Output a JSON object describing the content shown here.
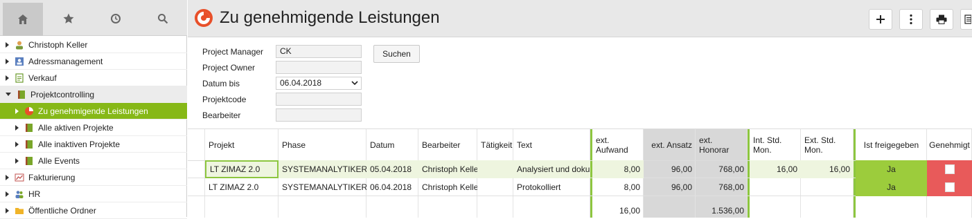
{
  "sidebar": {
    "items": [
      {
        "label": "Christoph Keller"
      },
      {
        "label": "Adressmanagement"
      },
      {
        "label": "Verkauf"
      },
      {
        "label": "Projektcontrolling"
      },
      {
        "label": "Zu genehmigende Leistungen"
      },
      {
        "label": "Alle aktiven Projekte"
      },
      {
        "label": "Alle inaktiven Projekte"
      },
      {
        "label": "Alle Events"
      },
      {
        "label": "Fakturierung"
      },
      {
        "label": "HR"
      },
      {
        "label": "Öffentliche Ordner"
      }
    ]
  },
  "header": {
    "title": "Zu genehmigende Leistungen"
  },
  "filters": {
    "project_manager": {
      "label": "Project Manager",
      "value": "CK"
    },
    "project_owner": {
      "label": "Project Owner",
      "value": ""
    },
    "date_until": {
      "label": "Datum bis",
      "value": "06.04.2018"
    },
    "project_code": {
      "label": "Projektcode",
      "value": ""
    },
    "editor": {
      "label": "Bearbeiter",
      "value": ""
    },
    "search_label": "Suchen"
  },
  "table": {
    "columns": [
      "Projekt",
      "Phase",
      "Datum",
      "Bearbeiter",
      "Tätigkeit",
      "Text",
      "ext. Aufwand",
      "ext. Ansatz",
      "ext. Honorar",
      "Int. Std. Mon.",
      "Ext. Std. Mon.",
      "Ist freigegeben",
      "Genehmigt"
    ],
    "rows": [
      {
        "projekt": "LT ZIMAZ 2.0",
        "phase": "SYSTEMANALYTIKER",
        "datum": "05.04.2018",
        "bearbeiter": "Christoph Keller",
        "taetigkeit": "",
        "text": "Analysiert und doku...",
        "ext_aufwand": "8,00",
        "ext_ansatz": "96,00",
        "ext_honorar": "768,00",
        "int_std": "16,00",
        "ext_std": "16,00",
        "freigegeben": "Ja"
      },
      {
        "projekt": "LT ZIMAZ 2.0",
        "phase": "SYSTEMANALYTIKER",
        "datum": "06.04.2018",
        "bearbeiter": "Christoph Keller",
        "taetigkeit": "",
        "text": "Protokolliert",
        "ext_aufwand": "8,00",
        "ext_ansatz": "96,00",
        "ext_honorar": "768,00",
        "int_std": "",
        "ext_std": "",
        "freigegeben": "Ja"
      }
    ],
    "totals": {
      "ext_aufwand": "16,00",
      "ext_honorar": "1.536,00"
    }
  },
  "colors": {
    "accent": "#86b817",
    "title_icon": "#e8502a",
    "approve_red": "#e85a5a",
    "released_green": "#9ccc3c"
  }
}
